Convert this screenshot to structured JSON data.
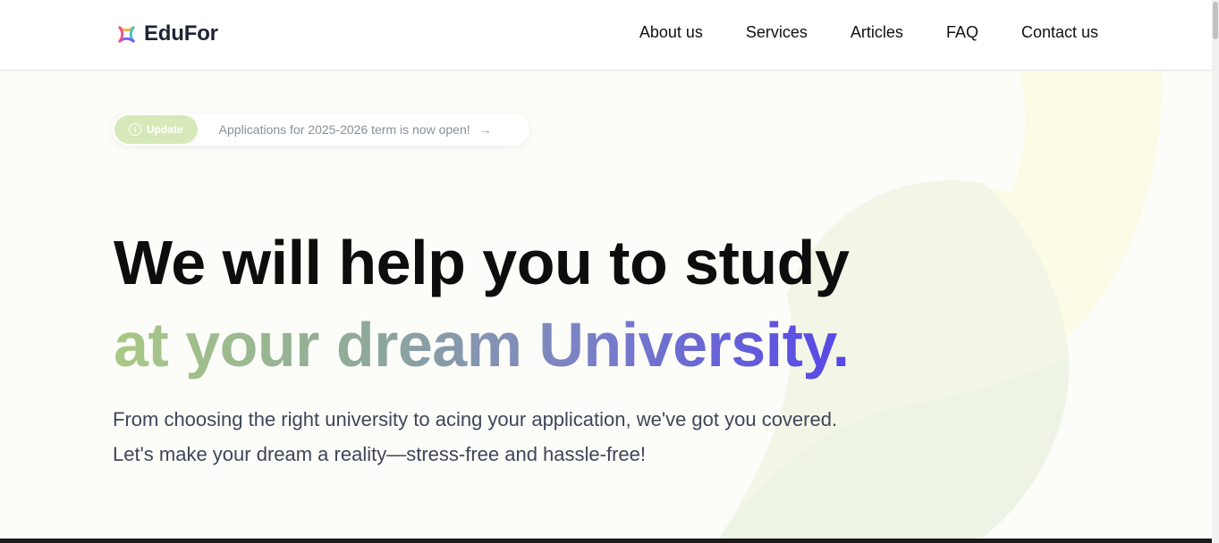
{
  "brand": {
    "name": "EduFor"
  },
  "nav": {
    "items": [
      "About us",
      "Services",
      "Articles",
      "FAQ",
      "Contact us"
    ]
  },
  "update": {
    "badge": "Update",
    "text": "Applications for 2025-2026 term is now open!",
    "arrow": "→"
  },
  "hero": {
    "line1": "We will help you to study",
    "line2": "at your dream University.",
    "subtitle": "From choosing the right university to acing your application, we've got you covered. Let's make your dream a reality—stress-free and hassle-free!"
  },
  "colors": {
    "accent_green": "#a9c986",
    "accent_purple": "#5546e8",
    "badge_bg": "#d7e9b9",
    "text_dark": "#0d0d0d",
    "text_muted": "#3f4658"
  },
  "icons": {
    "logo": "edufor-logo-icon",
    "info": "info-icon",
    "arrow": "arrow-right-icon"
  }
}
